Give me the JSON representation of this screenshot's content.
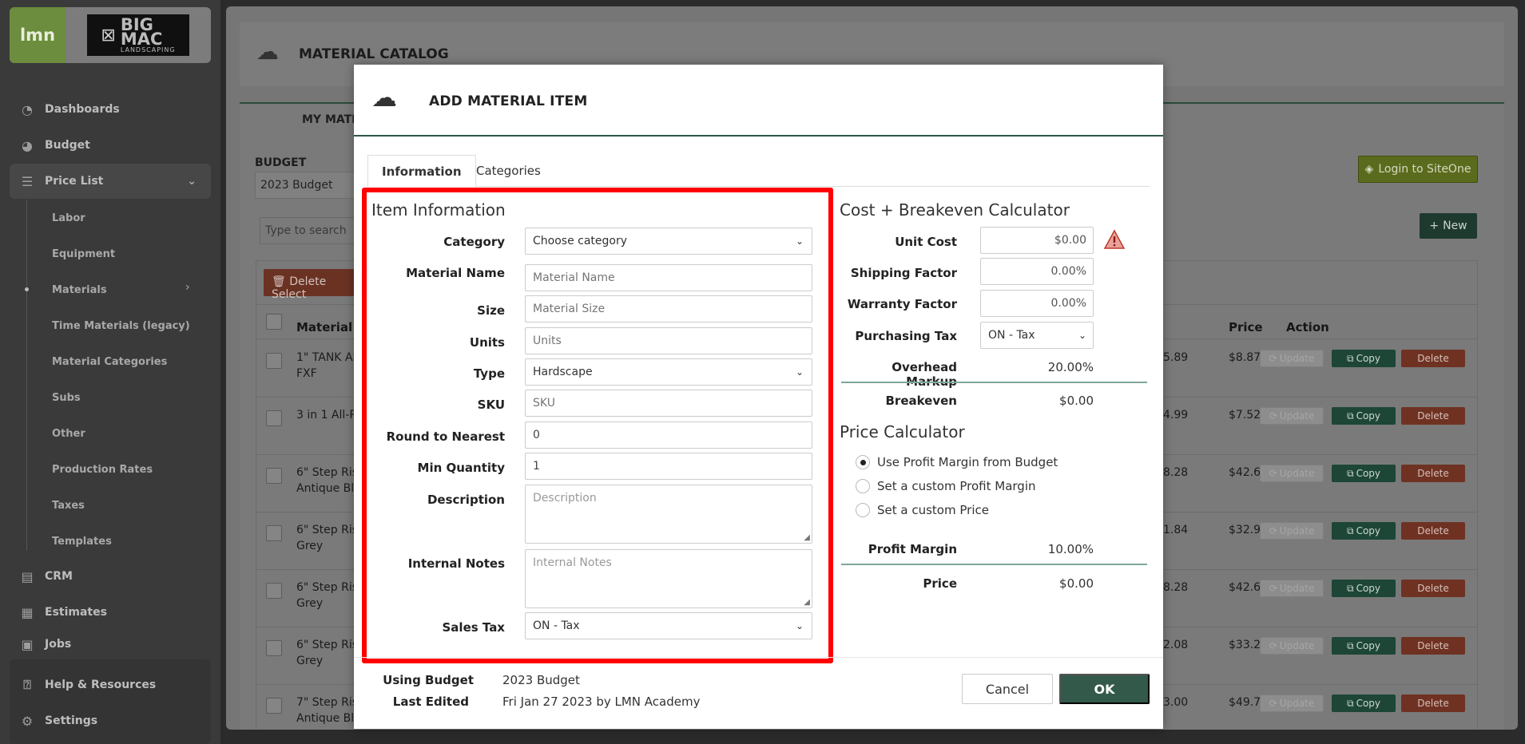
{
  "sidebar": {
    "brand": "lmn",
    "company_logo_line1": "BIG",
    "company_logo_line2": "MAC",
    "company_logo_line3": "LANDSCAPING",
    "items": [
      {
        "label": "Dashboards",
        "icon": "gauge-icon"
      },
      {
        "label": "Budget",
        "icon": "pie-chart-icon"
      },
      {
        "label": "Price List",
        "icon": "list-icon"
      },
      {
        "label": "CRM",
        "icon": "contacts-icon"
      },
      {
        "label": "Estimates",
        "icon": "calculator-icon"
      },
      {
        "label": "Jobs",
        "icon": "briefcase-icon"
      },
      {
        "label": "Help & Resources",
        "icon": "help-icon"
      },
      {
        "label": "Settings",
        "icon": "gear-icon"
      }
    ],
    "price_list_sub": [
      "Labor",
      "Equipment",
      "Materials",
      "Time Materials (legacy)",
      "Material Categories",
      "Subs",
      "Other",
      "Production Rates",
      "Taxes",
      "Templates"
    ]
  },
  "background": {
    "page_title": "MATERIAL CATALOG",
    "tab_label": "MY MATE",
    "budget_label": "BUDGET",
    "budget_value": "2023 Budget",
    "search_placeholder": "Type to search",
    "siteone_label": "Login to SiteOne",
    "new_label": "New",
    "delete_selected_label": "Delete Select",
    "col_material": "Material N",
    "col_price": "Price",
    "col_action": "Action",
    "update_label": "Update",
    "copy_label": "Copy",
    "delete_label": "Delete",
    "rows": [
      {
        "name1": "1\" TANK AD",
        "name2": "FXF",
        "cost": "5.89",
        "price": "$8.87"
      },
      {
        "name1": "3 in 1 All-P",
        "name2": "",
        "cost": "4.99",
        "price": "$7.52"
      },
      {
        "name1": "6\" Step Ris",
        "name2": "Antique Bla",
        "cost": "8.28",
        "price": "$42.61"
      },
      {
        "name1": "6\" Step Ris",
        "name2": "Grey",
        "cost": "1.84",
        "price": "$32.91"
      },
      {
        "name1": "6\" Step Ris",
        "name2": "Grey",
        "cost": "8.28",
        "price": "$42.61"
      },
      {
        "name1": "6\" Step Ris",
        "name2": "Grey",
        "cost": "2.08",
        "price": "$33.27"
      },
      {
        "name1": "7\" Step Ris",
        "name2": "Antique Bla",
        "cost": "3.00",
        "price": "$49.72"
      }
    ]
  },
  "modal": {
    "title": "ADD MATERIAL ITEM",
    "tabs": [
      "Information",
      "Categories"
    ],
    "item_info": {
      "title": "Item Information",
      "category_label": "Category",
      "category_value": "Choose category",
      "material_name_label": "Material Name",
      "material_name_placeholder": "Material Name",
      "size_label": "Size",
      "size_placeholder": "Material Size",
      "units_label": "Units",
      "units_placeholder": "Units",
      "type_label": "Type",
      "type_value": "Hardscape",
      "sku_label": "SKU",
      "sku_placeholder": "SKU",
      "round_label": "Round to Nearest",
      "round_value": "0",
      "min_qty_label": "Min Quantity",
      "min_qty_value": "1",
      "description_label": "Description",
      "description_placeholder": "Description",
      "notes_label": "Internal Notes",
      "notes_placeholder": "Internal Notes",
      "sales_tax_label": "Sales Tax",
      "sales_tax_value": "ON - Tax"
    },
    "calculator": {
      "title": "Cost + Breakeven Calculator",
      "unit_cost_label": "Unit Cost",
      "unit_cost_value": "$0.00",
      "shipping_label": "Shipping Factor",
      "shipping_value": "0.00%",
      "warranty_label": "Warranty Factor",
      "warranty_value": "0.00%",
      "purchasing_tax_label": "Purchasing Tax",
      "purchasing_tax_value": "ON - Tax",
      "overhead_label": "Overhead Markup",
      "overhead_value": "20.00%",
      "breakeven_label": "Breakeven",
      "breakeven_value": "$0.00"
    },
    "price_calc": {
      "title": "Price Calculator",
      "options": [
        "Use Profit Margin from Budget",
        "Set a custom Profit Margin",
        "Set a custom Price"
      ],
      "selected_index": 0,
      "profit_margin_label": "Profit Margin",
      "profit_margin_value": "10.00%",
      "price_label": "Price",
      "price_value": "$0.00"
    },
    "footer": {
      "using_budget_label": "Using Budget",
      "using_budget_value": "2023 Budget",
      "last_edited_label": "Last Edited",
      "last_edited_value": "Fri Jan 27 2023 by LMN Academy",
      "cancel_label": "Cancel",
      "ok_label": "OK"
    }
  },
  "colors": {
    "accent_green": "#33594a",
    "highlight_red": "#ff0000",
    "warning": "#d9534f"
  }
}
